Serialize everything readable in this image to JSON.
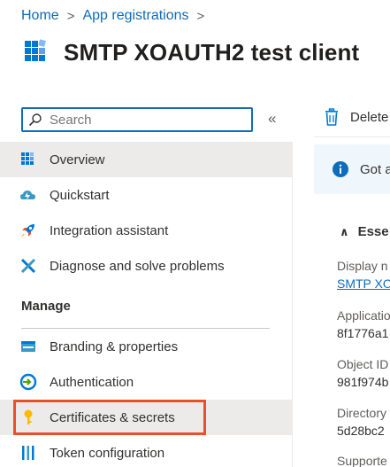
{
  "breadcrumb": {
    "home": "Home",
    "sep1": ">",
    "app_regs": "App registrations",
    "sep2": ">"
  },
  "page_title": "SMTP XOAUTH2 test client",
  "search": {
    "placeholder": "Search",
    "collapse": "«"
  },
  "nav": {
    "overview": "Overview",
    "quickstart": "Quickstart",
    "integration": "Integration assistant",
    "diagnose": "Diagnose and solve problems",
    "manage_label": "Manage",
    "branding": "Branding & properties",
    "authentication": "Authentication",
    "certificates": "Certificates & secrets",
    "token": "Token configuration"
  },
  "toolbar": {
    "delete": "Delete"
  },
  "infobar": {
    "text": "Got a"
  },
  "essentials": {
    "header": "Esse",
    "chevron": "∧",
    "display_name_label": "Display n",
    "display_name_value": "SMTP XO",
    "app_id_label": "Applicatio",
    "app_id_value": "8f1776a1",
    "object_id_label": "Object ID",
    "object_id_value": "981f974b",
    "directory_label": "Directory",
    "directory_value": "5d28bc2",
    "supported_label": "Supporte"
  },
  "colors": {
    "accent": "#0f6cbd",
    "highlight": "#e8502b",
    "active_bg": "#edebe9"
  }
}
